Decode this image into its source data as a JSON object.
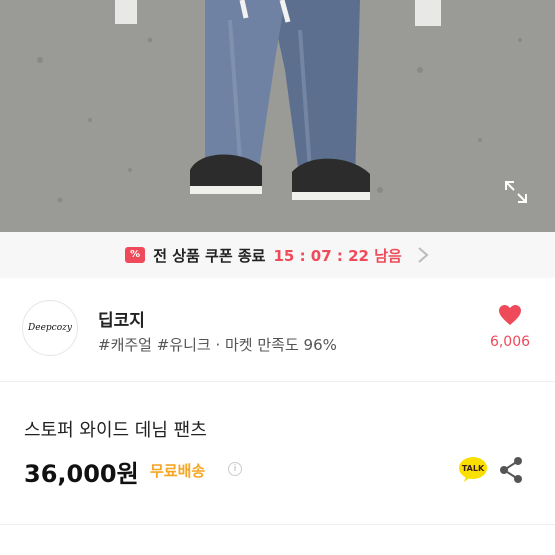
{
  "coupon": {
    "icon": "coupon-ticket-icon",
    "text": "전 상품 쿠폰 종료",
    "timer": "15 : 07 : 22 남음"
  },
  "seller": {
    "name": "딥코지",
    "avatar_text": "Deepcozy",
    "tags": "#캐주얼 #유니크 · 마켓 만족도 96%",
    "likes": "6,006"
  },
  "product": {
    "title": "스토퍼 와이드 데님 팬츠",
    "price": "36,000원",
    "shipping": "무료배송",
    "talk_label": "TALK"
  },
  "colors": {
    "accent_red": "#ef4a5a",
    "shipping_orange": "#f5a623",
    "talk_yellow": "#f9e000"
  }
}
